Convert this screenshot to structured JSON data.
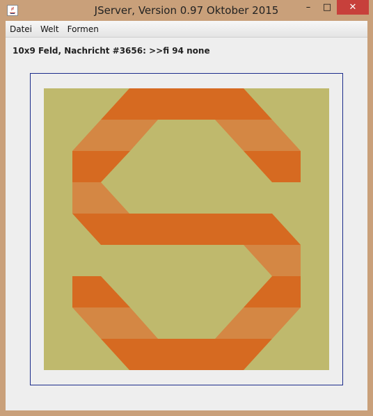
{
  "window": {
    "title": "JServer, Version 0.97 Oktober 2015",
    "icon": "java-icon",
    "controls": {
      "minimize": "–",
      "maximize": "□",
      "close": "✕"
    }
  },
  "menu": [
    "Datei",
    "Welt",
    "Formen"
  ],
  "status": "10x9 Feld, Nachricht #3656: >>fi 94 none",
  "board": {
    "columns": 10,
    "rows": 9,
    "colors": {
      "background": "#bfb96d",
      "dark": "#d66a21",
      "light": "#d48744"
    }
  }
}
